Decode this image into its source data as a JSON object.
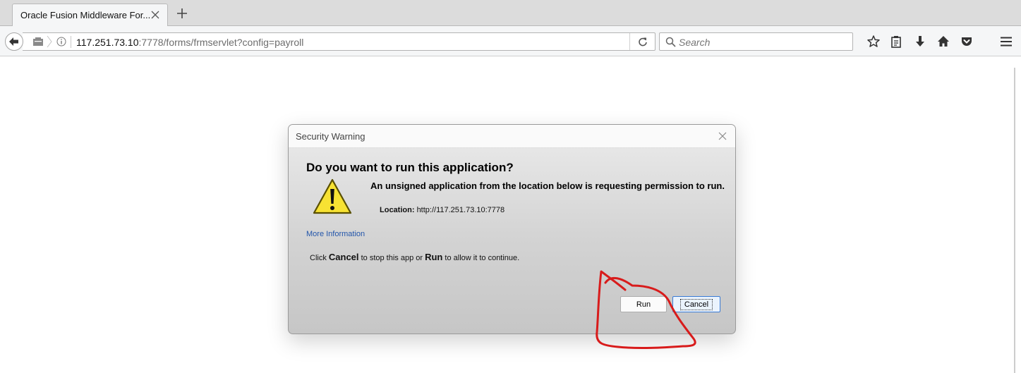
{
  "browser": {
    "tab_title": "Oracle Fusion Middleware For...",
    "url_host": "117.251.73.10",
    "url_rest": ":7778/forms/frmservlet?config=payroll",
    "search_placeholder": "Search"
  },
  "dialog": {
    "title": "Security Warning",
    "heading": "Do you want to run this application?",
    "message": "An unsigned application from the location below is requesting permission to run.",
    "location_label": "Location:",
    "location_value": "http://117.251.73.10:7778",
    "more_info_link": "More Information",
    "instruction": {
      "part1": "Click ",
      "cancel_word": "Cancel",
      "part2": " to stop this app or ",
      "run_word": "Run",
      "part3": " to allow it to continue."
    },
    "run_button": "Run",
    "cancel_button": "Cancel"
  },
  "colors": {
    "annotation": "#d81b1b",
    "warning_fill": "#f7e233",
    "link": "#2255aa"
  },
  "icons": {
    "back": "back-arrow-icon",
    "identity": "page-identity-icon",
    "info": "info-icon",
    "reload": "reload-icon",
    "search": "search-icon",
    "bookmark": "star-icon",
    "reading_list": "clipboard-icon",
    "downloads": "download-arrow-icon",
    "home": "home-icon",
    "pocket": "pocket-icon",
    "menu": "hamburger-menu-icon",
    "warning": "warning-triangle-icon"
  }
}
